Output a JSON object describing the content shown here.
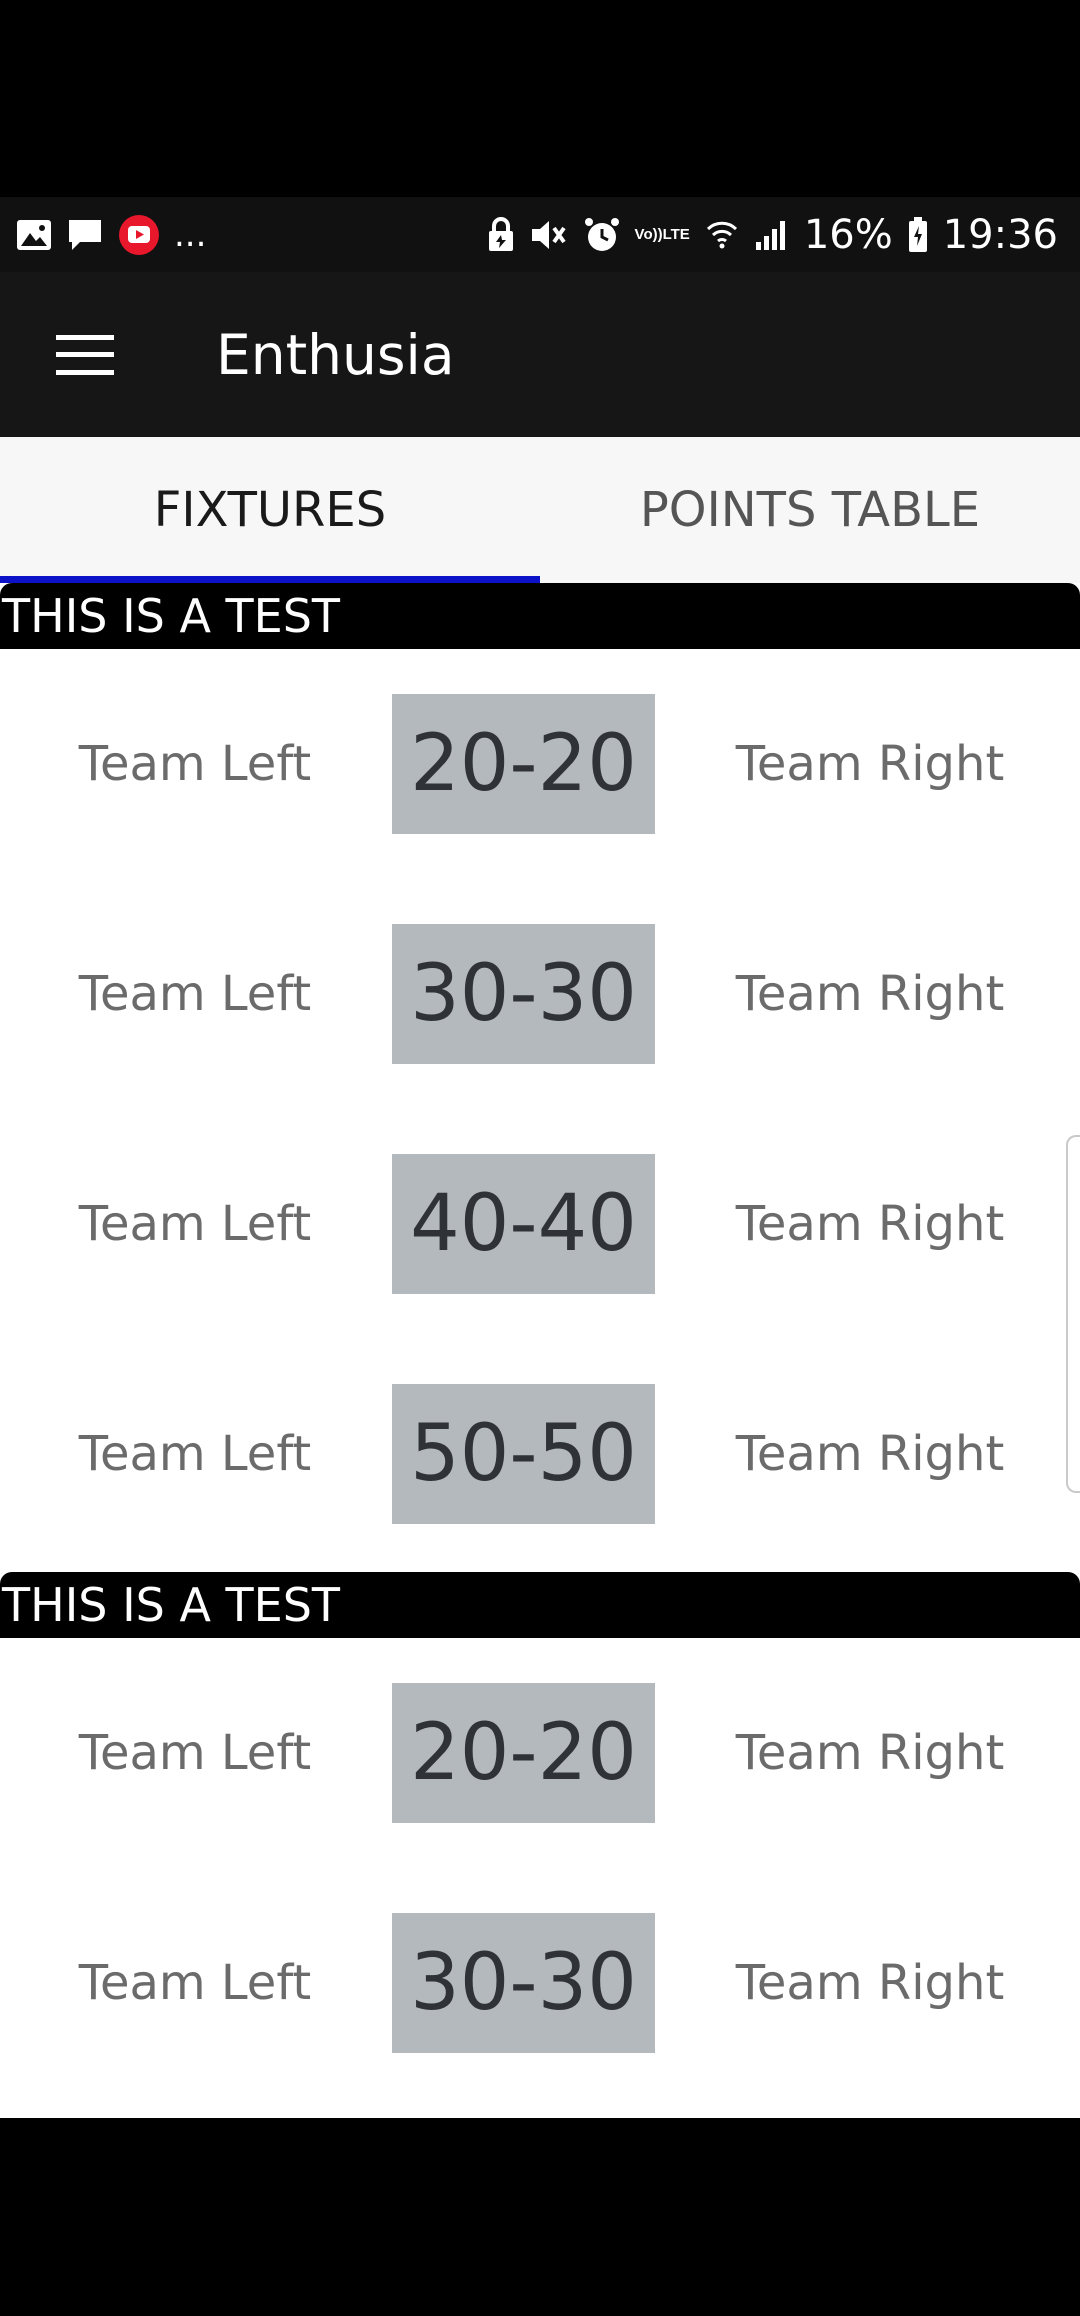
{
  "status_bar": {
    "battery": "16%",
    "time": "19:36",
    "network_top": "Vo))",
    "network_bottom": "LTE",
    "more": "..."
  },
  "app_bar": {
    "title": "Enthusia"
  },
  "tabs": [
    {
      "label": "FIXTURES",
      "active": true
    },
    {
      "label": "POINTS TABLE",
      "active": false
    }
  ],
  "sections": [
    {
      "header": "THIS IS A TEST",
      "fixtures": [
        {
          "left": "Team Left",
          "score": "20-20",
          "right": "Team Right"
        },
        {
          "left": "Team Left",
          "score": "30-30",
          "right": "Team Right"
        },
        {
          "left": "Team Left",
          "score": "40-40",
          "right": "Team Right"
        },
        {
          "left": "Team Left",
          "score": "50-50",
          "right": "Team Right"
        }
      ]
    },
    {
      "header": "THIS IS A TEST",
      "fixtures": [
        {
          "left": "Team Left",
          "score": "20-20",
          "right": "Team Right"
        },
        {
          "left": "Team Left",
          "score": "30-30",
          "right": "Team Right"
        }
      ]
    }
  ],
  "colors": {
    "tab_indicator": "#0b12c8",
    "score_bg": "#b4b9bd",
    "app_bar": "#161616"
  }
}
